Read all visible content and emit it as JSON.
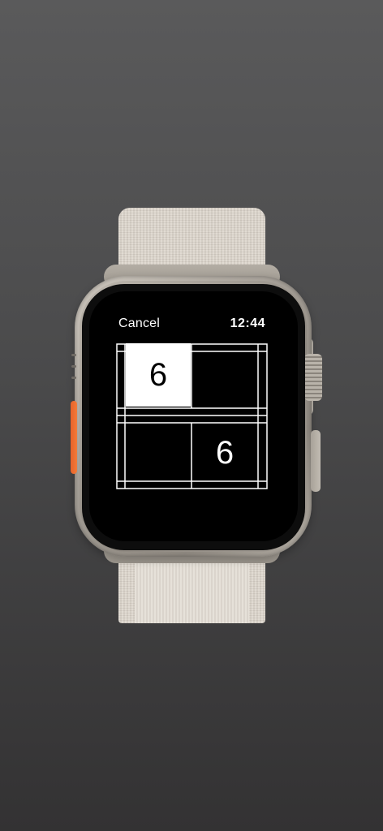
{
  "header": {
    "cancel_label": "Cancel",
    "time": "12:44"
  },
  "scoreboard": {
    "player_one_score": "6",
    "player_two_score": "6"
  },
  "colors": {
    "action_button": "#f27b38",
    "screen_background": "#000000",
    "highlight": "#ffffff"
  }
}
